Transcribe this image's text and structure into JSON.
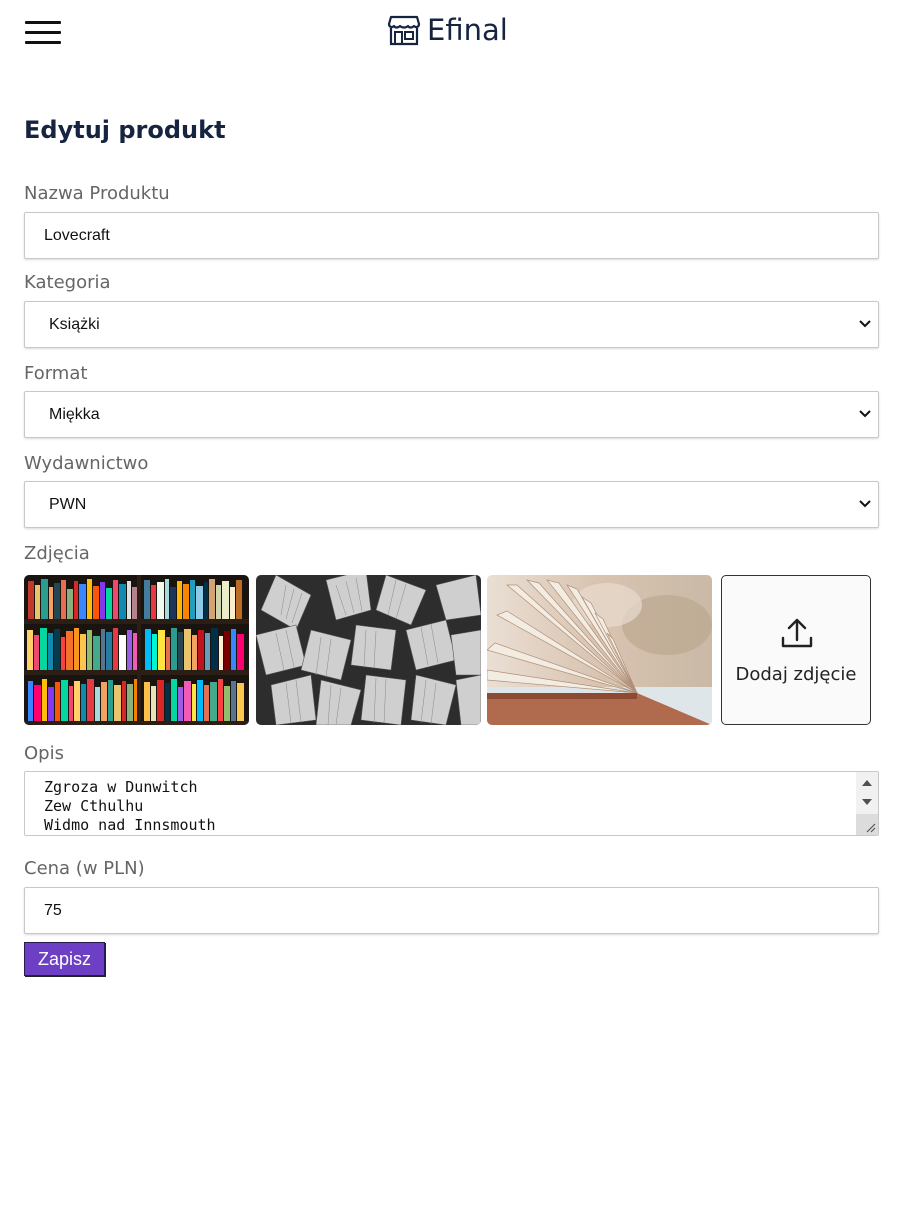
{
  "header": {
    "brand_name": "Efinal",
    "menu_icon": "hamburger-menu-icon",
    "logo_icon": "storefront-icon"
  },
  "page": {
    "title": "Edytuj produkt"
  },
  "form": {
    "name": {
      "label": "Nazwa Produktu",
      "value": "Lovecraft"
    },
    "category": {
      "label": "Kategoria",
      "value": "Książki"
    },
    "format": {
      "label": "Format",
      "value": "Miękka"
    },
    "publisher": {
      "label": "Wydawnictwo",
      "value": "PWN"
    },
    "photos": {
      "label": "Zdjęcia",
      "add_label": "Dodaj zdjęcie",
      "add_icon": "upload-icon"
    },
    "description": {
      "label": "Opis",
      "lines": [
        "Zgroza w Dunwitch",
        "Zew Cthulhu",
        "Widmo nad Innsmouth"
      ]
    },
    "price": {
      "label": "Cena (w PLN)",
      "value": "75"
    },
    "save_label": "Zapisz"
  },
  "colors": {
    "brand_text": "#16243f",
    "save_button": "#6c3fc4"
  }
}
